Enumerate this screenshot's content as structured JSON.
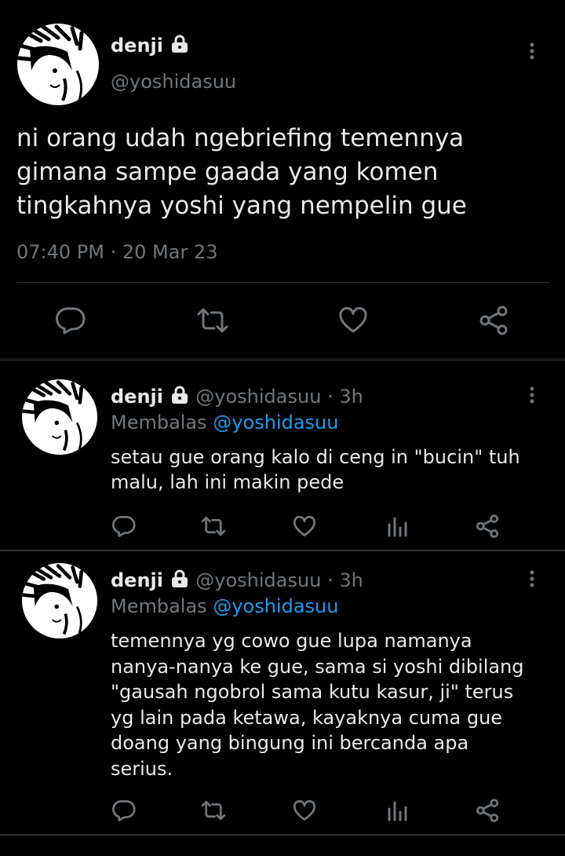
{
  "main_tweet": {
    "display_name": "denji",
    "handle": "@yoshidasuu",
    "text_lines": [
      "ni orang udah ngebriefing temennya",
      "gimana sampe gaada yang komen",
      "tingkahnya yoshi yang nempelin gue"
    ],
    "timestamp": "07:40 PM · 20 Mar 23"
  },
  "replies": [
    {
      "display_name": "denji",
      "handle": "@yoshidasuu",
      "time": "· 3h",
      "replying_prefix": "Membalas",
      "replying_to": "@yoshidasuu",
      "text_lines": [
        "setau gue orang kalo di ceng in \"bucin\" tuh",
        "malu, lah ini makin pede"
      ]
    },
    {
      "display_name": "denji",
      "handle": "@yoshidasuu",
      "time": "· 3h",
      "replying_prefix": "Membalas",
      "replying_to": "@yoshidasuu",
      "text_lines": [
        "temennya yg cowo gue lupa namanya",
        "nanya-nanya ke gue, sama si yoshi dibilang",
        "\"gausah ngobrol sama kutu kasur, ji\" terus",
        "yg lain pada ketawa, kayaknya cuma gue",
        "doang yang bingung ini bercanda apa",
        "serius."
      ]
    }
  ],
  "icons": {
    "reply": "reply-icon",
    "retweet": "retweet-icon",
    "like": "heart-icon",
    "views": "views-icon",
    "share": "share-icon",
    "more": "more-vertical-icon",
    "lock": "lock-icon"
  },
  "colors": {
    "background": "#000000",
    "text": "#e7e9ea",
    "muted": "#71767b",
    "link": "#1d9bf0",
    "divider": "#2f3336"
  }
}
